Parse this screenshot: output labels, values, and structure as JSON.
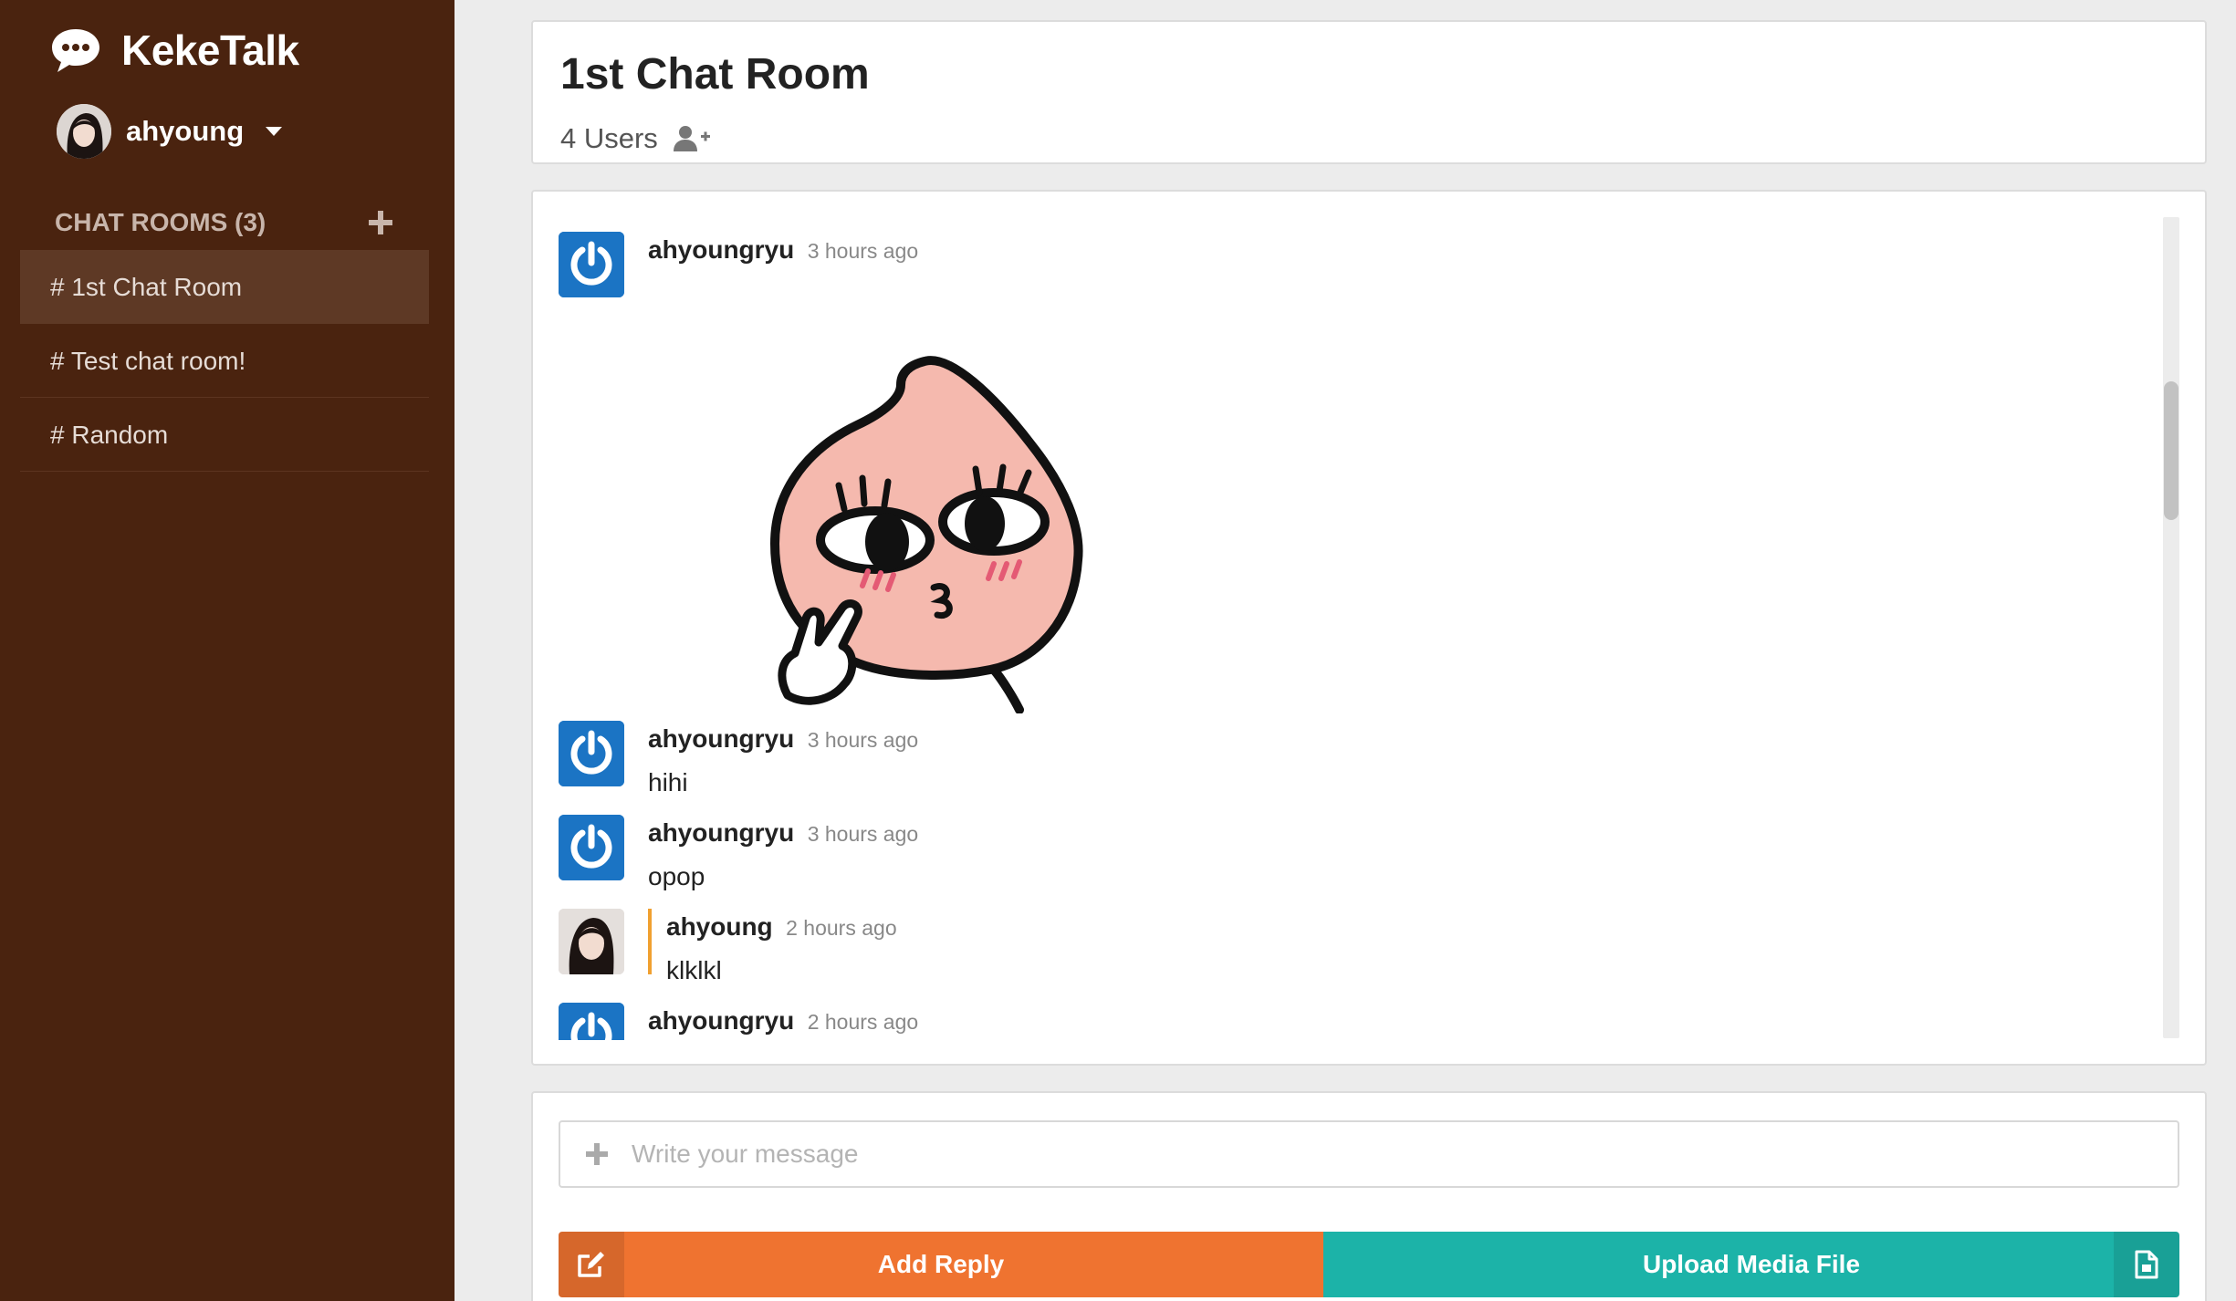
{
  "app": {
    "title": "KekeTalk"
  },
  "user": {
    "name": "ahyoung"
  },
  "sidebar": {
    "rooms_title": "CHAT ROOMS (3)",
    "rooms": [
      {
        "label": "# 1st Chat Room",
        "active": true
      },
      {
        "label": "# Test chat room!",
        "active": false
      },
      {
        "label": "# Random",
        "active": false
      }
    ]
  },
  "room": {
    "title": "1st Chat Room",
    "users": "4 Users"
  },
  "messages": [
    {
      "author": "ahyoungryu",
      "time": "3 hours ago",
      "text": "",
      "has_sticker": true
    },
    {
      "author": "ahyoungryu",
      "time": "3 hours ago",
      "text": "hihi"
    },
    {
      "author": "ahyoungryu",
      "time": "3 hours ago",
      "text": "opop"
    },
    {
      "author": "ahyoung",
      "time": "2 hours ago",
      "text": "klklkl",
      "quoted": true
    },
    {
      "author": "ahyoungryu",
      "time": "2 hours ago",
      "text": ""
    }
  ],
  "compose": {
    "placeholder": "Write your message",
    "value": ""
  },
  "actions": {
    "reply_label": "Add Reply",
    "upload_label": "Upload Media File"
  },
  "colors": {
    "sidebar_bg": "#4a230f",
    "active_room_bg": "#5e3925",
    "reply_button": "#ef7330",
    "upload_button": "#1cb3a8",
    "bot_avatar": "#1b74c4",
    "quote_bar": "#f0a030"
  },
  "icons": {
    "brand": "chat-bubble-icon",
    "caret": "caret-down-icon",
    "add_room": "plus-icon",
    "add_user": "user-plus-icon",
    "bot_avatar": "power-icon",
    "compose_attach": "plus-icon",
    "reply": "edit-icon",
    "upload": "file-icon"
  }
}
